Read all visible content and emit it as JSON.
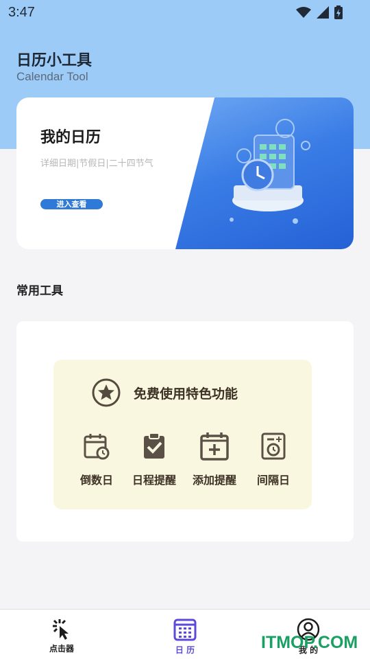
{
  "status_bar": {
    "time": "3:47"
  },
  "header": {
    "title": "日历小工具",
    "subtitle": "Calendar Tool"
  },
  "banner": {
    "title": "我的日历",
    "description": "详细日期|节假日|二十四节气",
    "button_label": "进入查看"
  },
  "section": {
    "title": "常用工具"
  },
  "promo": {
    "title": "免费使用特色功能",
    "features": [
      {
        "label": "倒数日",
        "icon": "calendar-clock-icon"
      },
      {
        "label": "日程提醒",
        "icon": "clipboard-check-icon"
      },
      {
        "label": "添加提醒",
        "icon": "calendar-plus-icon"
      },
      {
        "label": "间隔日",
        "icon": "calendar-interval-icon"
      }
    ]
  },
  "bottom_nav": {
    "items": [
      {
        "label": "点击器",
        "icon": "cursor-click-icon",
        "active": false
      },
      {
        "label": "日 历",
        "icon": "calendar-grid-icon",
        "active": true
      },
      {
        "label": "我 的",
        "icon": "user-icon",
        "active": false
      }
    ]
  },
  "watermark": "ITMOP.COM",
  "colors": {
    "accent": "#5b4ad9",
    "header_bg": "#9dcbf7",
    "promo_bg": "#faf7e0",
    "button_blue": "#2f7ad6"
  }
}
